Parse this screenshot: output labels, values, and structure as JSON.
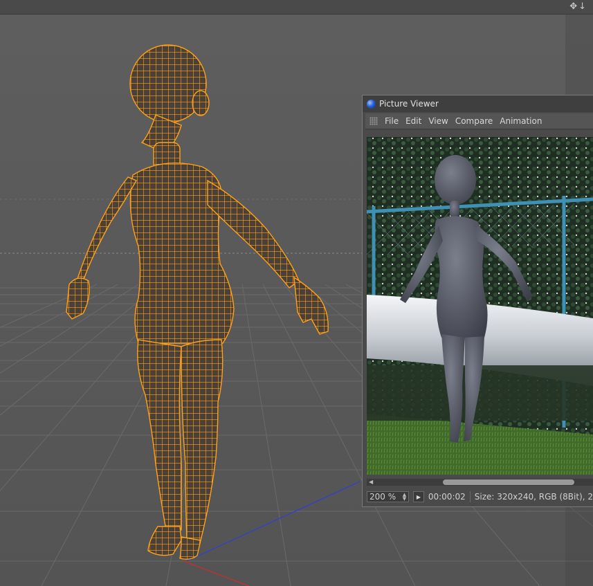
{
  "topbar": {
    "move_icon": "move-cross-icon",
    "down_icon": "arrow-down-icon"
  },
  "picture_viewer": {
    "title": "Picture Viewer",
    "title_icon": "cinema4d-orb-icon",
    "menu": [
      "File",
      "Edit",
      "View",
      "Compare",
      "Animation"
    ],
    "zoom": "200 %",
    "time": "00:00:02",
    "info": "Size: 320x240, RGB (8Bit), 2"
  },
  "colors": {
    "wireframe": "#ffa21a",
    "background": "#5a5a5a",
    "grid": "#6c6c6c"
  }
}
